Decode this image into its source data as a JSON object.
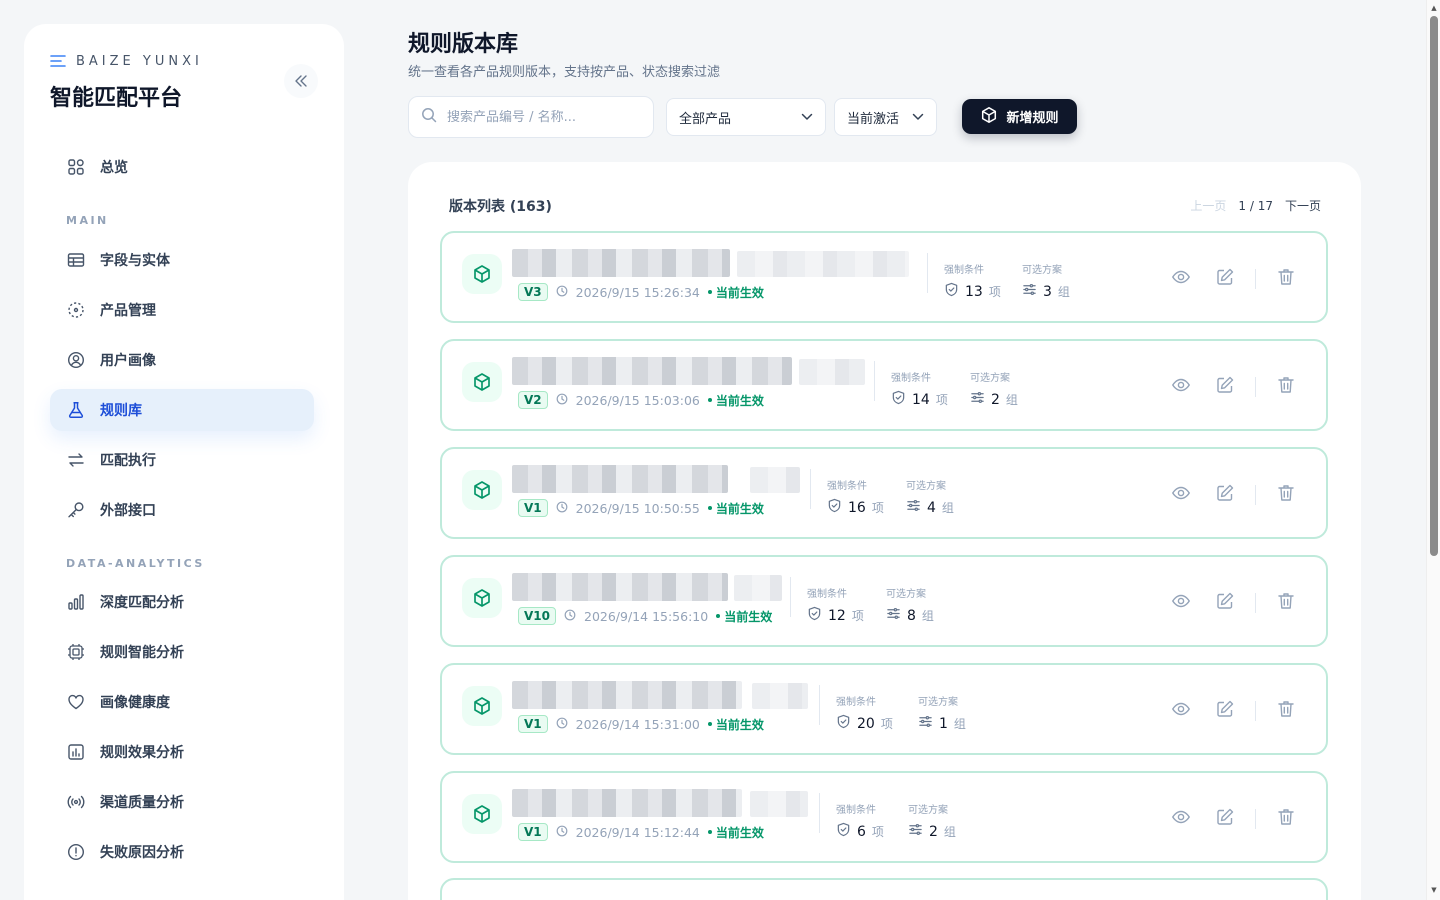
{
  "colors": {
    "accent": "#1d4ed8",
    "active_bg": "#e6f0fb",
    "success": "#059669",
    "dark_button": "#0f172a",
    "card_border": "#bfeadb"
  },
  "brand": {
    "subtitle": "BAIZE YUNXI",
    "title": "智能匹配平台"
  },
  "sidebar": {
    "overview": {
      "label": "总览",
      "icon": "grid-icon"
    },
    "sections": [
      {
        "title": "MAIN"
      },
      {
        "title": "DATA-ANALYTICS"
      }
    ],
    "main_items": [
      {
        "label": "字段与实体",
        "icon": "table-icon",
        "active": false
      },
      {
        "label": "产品管理",
        "icon": "box-dashed-icon",
        "active": false
      },
      {
        "label": "用户画像",
        "icon": "user-circle-icon",
        "active": false
      },
      {
        "label": "规则库",
        "icon": "flask-icon",
        "active": true
      },
      {
        "label": "匹配执行",
        "icon": "swap-icon",
        "active": false
      },
      {
        "label": "外部接口",
        "icon": "key-icon",
        "active": false
      }
    ],
    "analytics_items": [
      {
        "label": "深度匹配分析",
        "icon": "bar-chart-icon"
      },
      {
        "label": "规则智能分析",
        "icon": "cpu-icon"
      },
      {
        "label": "画像健康度",
        "icon": "heart-icon"
      },
      {
        "label": "规则效果分析",
        "icon": "chart-box-icon"
      },
      {
        "label": "渠道质量分析",
        "icon": "signal-icon"
      },
      {
        "label": "失败原因分析",
        "icon": "alert-circle-icon"
      }
    ]
  },
  "header": {
    "title": "规则版本库",
    "subtitle": "统一查看各产品规则版本，支持按产品、状态搜索过滤"
  },
  "toolbar": {
    "search_placeholder": "搜索产品编号 / 名称...",
    "product_filter": "全部产品",
    "status_filter": "当前激活",
    "new_button": "新增规则"
  },
  "list": {
    "title": "版本列表 (163)",
    "pager": {
      "prev": "上一页",
      "page": "1 / 17",
      "next": "下一页"
    },
    "stat_labels": {
      "mandatory": "强制条件",
      "optional": "可选方案"
    },
    "units": {
      "mandatory": "项",
      "optional": "组"
    },
    "rows": [
      {
        "version": "V3",
        "time": "2026/9/15 15:26:34",
        "status": "当前生效",
        "mandatory": "13",
        "optional": "3"
      },
      {
        "version": "V2",
        "time": "2026/9/15 15:03:06",
        "status": "当前生效",
        "mandatory": "14",
        "optional": "2"
      },
      {
        "version": "V1",
        "time": "2026/9/15 10:50:55",
        "status": "当前生效",
        "mandatory": "16",
        "optional": "4"
      },
      {
        "version": "V10",
        "time": "2026/9/14 15:56:10",
        "status": "当前生效",
        "mandatory": "12",
        "optional": "8"
      },
      {
        "version": "V1",
        "time": "2026/9/14 15:31:00",
        "status": "当前生效",
        "mandatory": "20",
        "optional": "1"
      },
      {
        "version": "V1",
        "time": "2026/9/14 15:12:44",
        "status": "当前生效",
        "mandatory": "6",
        "optional": "2"
      }
    ]
  }
}
